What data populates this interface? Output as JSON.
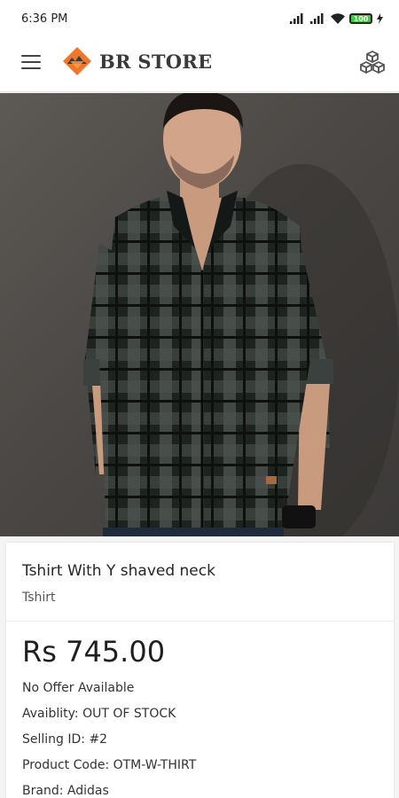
{
  "status_bar": {
    "time": "6:36 PM",
    "battery": "100"
  },
  "app_bar": {
    "brand": "BR STORE",
    "menu_icon": "hamburger-menu-icon",
    "cart_icon": "cubes-icon"
  },
  "carousel": {
    "image": "man-in-checkered-shirt-photo",
    "slide_count": 3,
    "active_slide": 3
  },
  "product": {
    "title": "Tshirt With Y shaved neck",
    "category": "Tshirt",
    "price": "Rs 745.00",
    "offer": "No Offer Available",
    "availability": "Avaiblity: OUT OF STOCK",
    "selling_id": "Selling ID: #2",
    "product_code": "Product Code: OTM-W-THIRT",
    "brand": "Brand: Adidas"
  },
  "colors": {
    "logo_orange": "#f2762a",
    "shirt_dark": "#1e2320",
    "background": "#f4f4f4"
  }
}
